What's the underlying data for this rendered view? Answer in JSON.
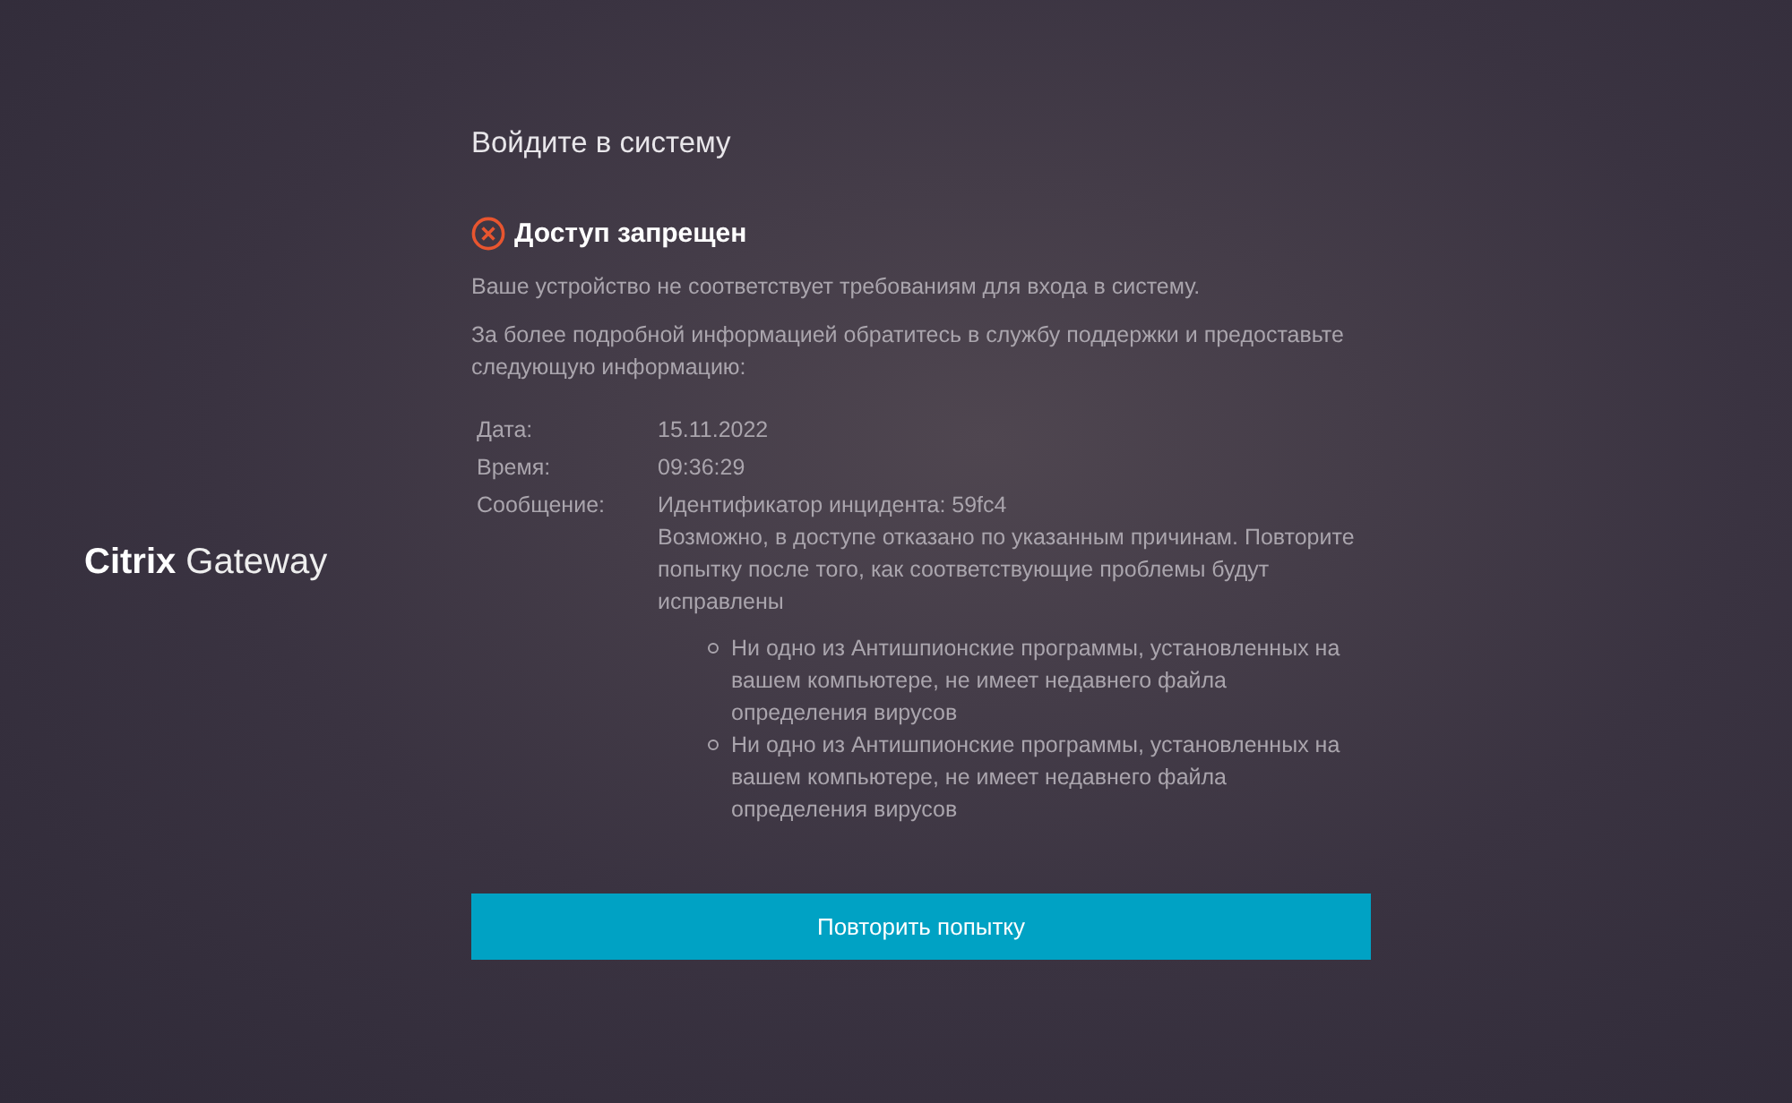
{
  "logo": {
    "text": "**Citrix** Gateway"
  },
  "title": "Войдите в систему",
  "error": {
    "heading": "Доступ запрещен",
    "paragraphs": [
      "Ваше устройство не соответствует требованиям для входа в систему.",
      "За более подробной информацией обратитесь в службу поддержки и предоставьте следующую информацию:"
    ]
  },
  "details": [
    {
      "label": "Дата:",
      "lines": [
        "15.11.2022"
      ]
    },
    {
      "label": "Время:",
      "lines": [
        "09:36:29"
      ]
    },
    {
      "label": "Сообщение:",
      "lines": [
        "Идентификатор инцидента: 59fc4",
        "Возможно, в доступе отказано по указанным причинам. Повторите попытку после того, как соответствующие проблемы будут исправлены"
      ]
    }
  ],
  "reasons": [
    "Ни одно из Антишпионские программы, установленных на вашем компьютере, не имеет недавнего файла определения вирусов",
    "Ни одно из Антишпионские программы, установленных на вашем компьютере, не имеет недавнего файла определения вирусов"
  ],
  "button": "Повторить попытку"
}
